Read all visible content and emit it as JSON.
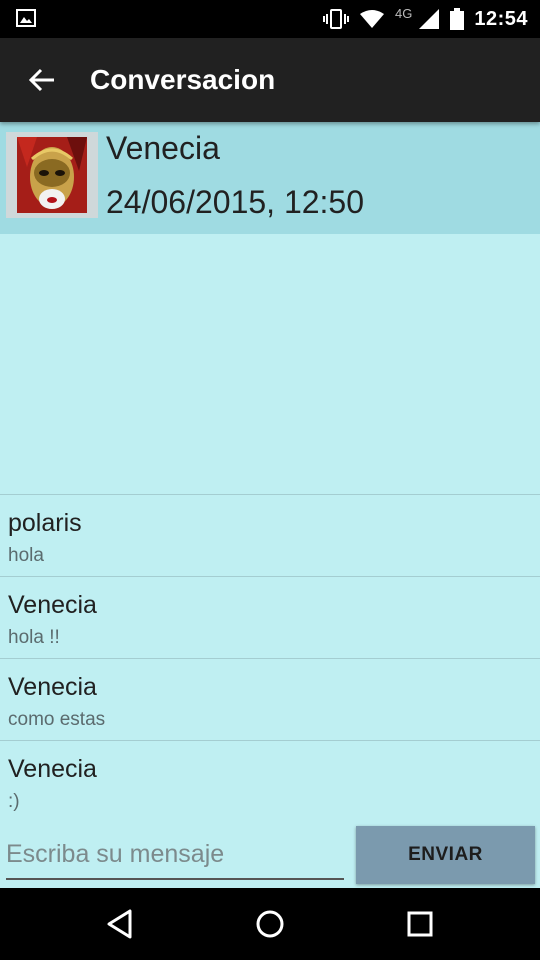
{
  "status_bar": {
    "time": "12:54",
    "network": "4G",
    "icons": [
      "image-icon",
      "vibrate-icon",
      "wifi-icon",
      "cell-signal-icon",
      "battery-icon"
    ]
  },
  "toolbar": {
    "title": "Conversacion",
    "back_icon": "arrow-back-icon"
  },
  "contact": {
    "name": "Venecia",
    "datetime": "24/06/2015, 12:50"
  },
  "messages": [
    {
      "sender": "polaris",
      "text": "hola"
    },
    {
      "sender": "Venecia",
      "text": "hola !!"
    },
    {
      "sender": "Venecia",
      "text": "como estas"
    },
    {
      "sender": "Venecia",
      "text": ":)"
    }
  ],
  "composer": {
    "placeholder": "Escriba su mensaje",
    "value": "",
    "send_label": "ENVIAR"
  },
  "nav_bar": {
    "icons": [
      "back-triangle-icon",
      "home-circle-icon",
      "recents-square-icon"
    ]
  },
  "colors": {
    "background": "#bfeff2",
    "header": "#9fdbe2",
    "toolbar": "#212121",
    "send_button": "#7b9aae"
  }
}
